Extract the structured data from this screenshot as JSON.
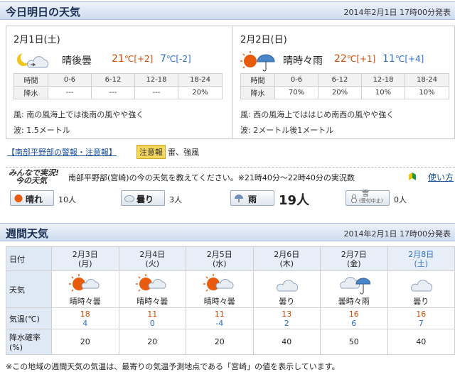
{
  "today": {
    "header_title": "今日明日の天気",
    "issued": "2014年2月1日 17時00分発表",
    "days": [
      {
        "date": "2月1日(土)",
        "weather": "晴後曇",
        "high": "21",
        "high_diff": "[+2]",
        "low": "7",
        "low_diff": "[-2]",
        "deg": "℃",
        "rain_headers": [
          "時間",
          "0-6",
          "6-12",
          "12-18",
          "18-24"
        ],
        "rain_label": "降水",
        "rain_values": [
          "---",
          "---",
          "---",
          "20%"
        ],
        "wind": "風: 南の風海上では後南の風やや強く",
        "wave": "波: 1.5メートル"
      },
      {
        "date": "2月2日(日)",
        "weather": "晴時々雨",
        "high": "22",
        "high_diff": "[+1]",
        "low": "11",
        "low_diff": "[+4]",
        "deg": "℃",
        "rain_headers": [
          "時間",
          "0-6",
          "6-12",
          "12-18",
          "18-24"
        ],
        "rain_label": "降水",
        "rain_values": [
          "70%",
          "20%",
          "10%",
          "10%"
        ],
        "wind": "風: 西の風海上でははじめ南西の風やや強く",
        "wave": "波: 2メートル後1メートル"
      }
    ]
  },
  "warning": {
    "link": "【南部平野部の警報・注意報】",
    "badge": "注意報",
    "text": "雷、強風"
  },
  "minna": {
    "logo_line1": "みんなで実況!",
    "logo_line2": "今の天気",
    "prompt": "南部平野部(宮崎)の今の天気を教えてください。※21時40分～22時40分の実況数",
    "help": "使い方",
    "votes": [
      {
        "label": "晴れ",
        "count": "10人"
      },
      {
        "label": "曇り",
        "count": "3人"
      },
      {
        "label": "雨",
        "count": "19人"
      },
      {
        "label": "雪",
        "sublabel": "(受付中止)",
        "count": "0人"
      }
    ]
  },
  "weekly": {
    "header_title": "週間天気",
    "issued": "2014年2月1日 17時00分発表",
    "row_labels": {
      "date": "日付",
      "weather": "天気",
      "temp": "気温(℃)",
      "pop": "降水確率(%)"
    },
    "days": [
      {
        "date": "2月3日",
        "dow": "(月)",
        "weather": "晴時々曇",
        "icon": "sun-cloud-icon",
        "high": "18",
        "low": "4",
        "pop": "20"
      },
      {
        "date": "2月4日",
        "dow": "(火)",
        "weather": "晴時々曇",
        "icon": "sun-cloud-icon",
        "high": "11",
        "low": "0",
        "pop": "20"
      },
      {
        "date": "2月5日",
        "dow": "(水)",
        "weather": "晴時々曇",
        "icon": "sun-cloud-icon",
        "high": "11",
        "low": "-4",
        "pop": "20"
      },
      {
        "date": "2月6日",
        "dow": "(木)",
        "weather": "曇り",
        "icon": "cloud-icon",
        "high": "13",
        "low": "2",
        "pop": "40"
      },
      {
        "date": "2月7日",
        "dow": "(金)",
        "weather": "曇時々雨",
        "icon": "cloud-rain-icon",
        "high": "16",
        "low": "6",
        "pop": "50"
      },
      {
        "date": "2月8日",
        "dow": "(土)",
        "weather": "曇り",
        "icon": "cloud-icon",
        "high": "16",
        "low": "7",
        "pop": "40"
      }
    ],
    "footnote": "※この地域の週間天気の気温は、最寄りの気温予測地点である「宮崎」の値を表示しています。"
  },
  "colors": {
    "high": "#d24a00",
    "low": "#2b6fc2",
    "link": "#1a4fa0",
    "header_bg": "#cddbee"
  }
}
